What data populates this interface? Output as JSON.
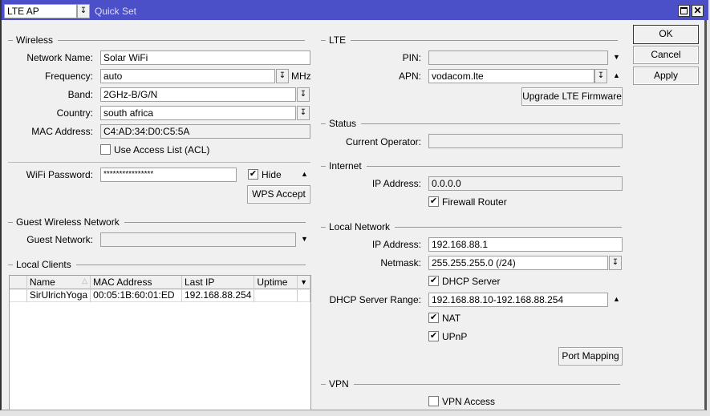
{
  "titlebar": {
    "mode_value": "LTE AP",
    "title": "Quick Set"
  },
  "buttons": {
    "ok": "OK",
    "cancel": "Cancel",
    "apply": "Apply"
  },
  "wireless": {
    "header": "Wireless",
    "network_name_label": "Network Name:",
    "network_name": "Solar WiFi",
    "frequency_label": "Frequency:",
    "frequency": "auto",
    "frequency_unit": "MHz",
    "band_label": "Band:",
    "band": "2GHz-B/G/N",
    "country_label": "Country:",
    "country": "south africa",
    "mac_label": "MAC Address:",
    "mac": "C4:AD:34:D0:C5:5A",
    "acl_label": "Use Access List (ACL)",
    "acl_checked": false,
    "password_label": "WiFi Password:",
    "password": "****************",
    "hide_label": "Hide",
    "hide_checked": true,
    "wps_button": "WPS Accept"
  },
  "guest": {
    "header": "Guest Wireless Network",
    "network_label": "Guest Network:",
    "network": ""
  },
  "clients": {
    "header": "Local Clients",
    "columns": [
      "Name",
      "MAC Address",
      "Last IP",
      "Uptime"
    ],
    "rows": [
      {
        "name": "SirUlrichYoga",
        "mac": "00:05:1B:60:01:ED",
        "ip": "192.168.88.254",
        "uptime": ""
      }
    ]
  },
  "lte": {
    "header": "LTE",
    "pin_label": "PIN:",
    "pin": "",
    "apn_label": "APN:",
    "apn": "vodacom.lte",
    "upgrade_button": "Upgrade LTE Firmware"
  },
  "status": {
    "header": "Status",
    "operator_label": "Current Operator:",
    "operator": ""
  },
  "internet": {
    "header": "Internet",
    "ip_label": "IP Address:",
    "ip": "0.0.0.0",
    "firewall_label": "Firewall Router",
    "firewall_checked": true
  },
  "local": {
    "header": "Local Network",
    "ip_label": "IP Address:",
    "ip": "192.168.88.1",
    "netmask_label": "Netmask:",
    "netmask": "255.255.255.0 (/24)",
    "dhcp_label": "DHCP Server",
    "dhcp_checked": true,
    "range_label": "DHCP Server Range:",
    "range": "192.168.88.10-192.168.88.254",
    "nat_label": "NAT",
    "nat_checked": true,
    "upnp_label": "UPnP",
    "upnp_checked": true,
    "port_mapping_button": "Port Mapping"
  },
  "vpn": {
    "header": "VPN",
    "access_label": "VPN Access",
    "access_checked": false
  },
  "colors": {
    "titlebar": "#4c50c8"
  }
}
